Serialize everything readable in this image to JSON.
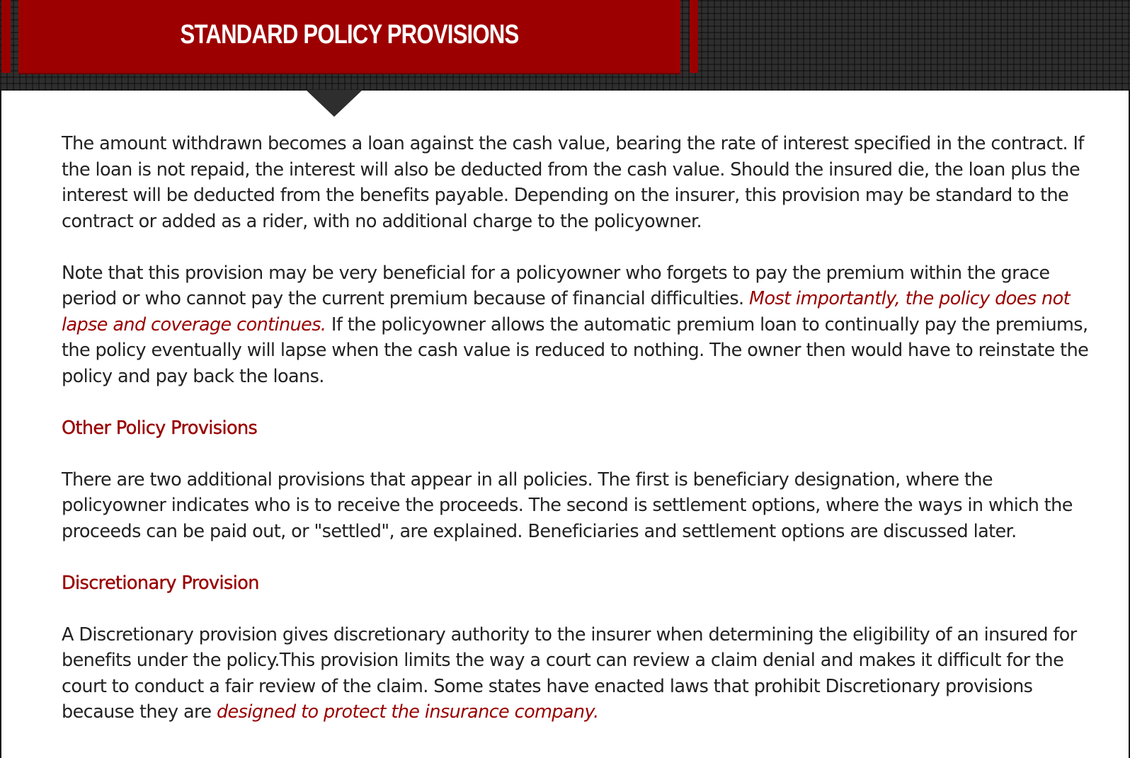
{
  "header": {
    "title": "STANDARD POLICY PROVISIONS"
  },
  "colors": {
    "accent": "#990000",
    "header_bg": "#2e2e2e",
    "text": "#222222"
  },
  "content": {
    "p1": "The amount withdrawn becomes a loan against the cash value, bearing the rate of interest specified in the contract. If the loan is not repaid, the interest will also be deducted from the cash value. Should the insured die, the loan plus the interest will be deducted from the benefits payable. Depending on the insurer, this provision may be standard to the contract or added as a rider, with no additional charge to the policyowner.",
    "p2_before": "Note that this provision may be very beneficial for a policyowner who forgets to pay the premium within the grace period or who cannot pay the current premium because of financial difficulties. ",
    "p2_emphasis": "Most importantly, the policy does not lapse and coverage continues.",
    "p2_after": " If the policyowner allows the automatic premium loan to continually pay the premiums, the policy eventually will lapse when the cash value is reduced to nothing. The owner then would have to reinstate the policy and pay back the loans.",
    "heading_other": "Other Policy Provisions",
    "p3": "There are two additional provisions that appear in all policies. The first is beneficiary designation, where the policyowner indicates who is to receive the proceeds. The second is settlement options, where the ways in which the proceeds can be paid out, or \"settled\", are explained. Beneficiaries and settlement options are discussed later.",
    "heading_discretionary": "Discretionary Provision",
    "p4_before": "A Discretionary provision gives discretionary authority to the insurer when determining the eligibility of an insured for benefits under the policy.This provision limits the way a court can review a claim denial and makes it difficult for the court to conduct a fair review of the claim. Some states have enacted laws that prohibit Discretionary provisions because they are ",
    "p4_emphasis": "designed to protect the insurance company."
  }
}
